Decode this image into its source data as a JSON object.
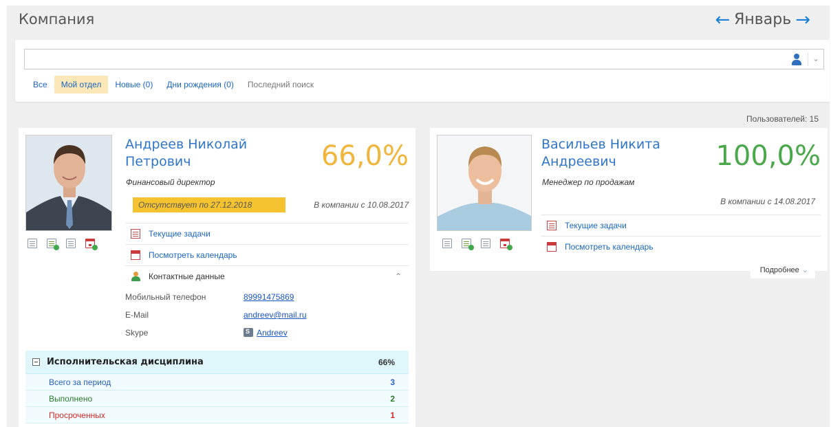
{
  "header": {
    "title": "Компания",
    "month": "Январь"
  },
  "search": {
    "value": "",
    "placeholder": ""
  },
  "filters": [
    {
      "label": "Все",
      "active": false
    },
    {
      "label": "Мой отдел",
      "active": true
    },
    {
      "label": "Новые (0)",
      "active": false
    },
    {
      "label": "Дни рождения (0)",
      "active": false
    },
    {
      "label": "Последний поиск",
      "active": false
    }
  ],
  "users_count": "Пользователей: 15",
  "employees": [
    {
      "name_line1": "Андреев Николай",
      "name_line2": "Петрович",
      "position": "Финансовый директор",
      "percent": "66,0%",
      "percent_color": "#f0b63c",
      "absence": "Отсутствует по 27.12.2018",
      "since": "В компании с 10.08.2017",
      "links": {
        "tasks": "Текущие задачи",
        "calendar": "Посмотреть календарь",
        "contacts": "Контактные данные"
      },
      "contacts": {
        "mobile_label": "Мобильный телефон",
        "mobile": "89991475869",
        "email_label": "E-Mail",
        "email": "andreev@mail.ru",
        "skype_label": "Skype",
        "skype": "Andreev"
      },
      "discipline": {
        "title": "Исполнительская дисциплина",
        "percent": "66%",
        "rows": [
          {
            "label": "Всего за период",
            "value": "3"
          },
          {
            "label": "Выполнено",
            "value": "2"
          },
          {
            "label": "Просроченных",
            "value": "1"
          }
        ]
      }
    },
    {
      "name_line1": "Васильев Никита",
      "name_line2": "Андреевич",
      "position": "Менеджер по продажам",
      "percent": "100,0%",
      "percent_color": "#4aa84a",
      "since": "В компании с 14.08.2017",
      "links": {
        "tasks": "Текущие задачи",
        "calendar": "Посмотреть календарь"
      },
      "more": "Подробнее"
    }
  ]
}
